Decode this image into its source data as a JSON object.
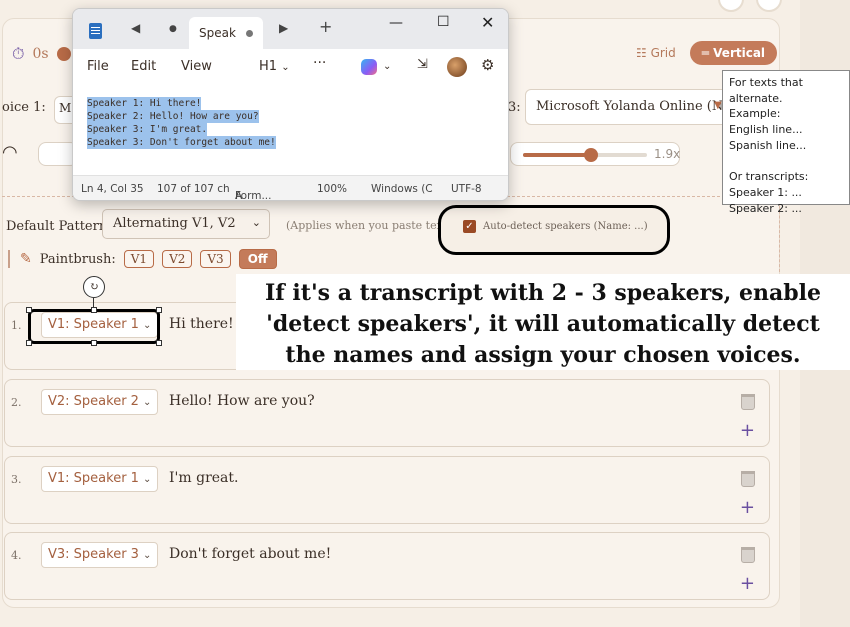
{
  "timer": {
    "value": "0s"
  },
  "view_toggle": {
    "grid_label": "Grid",
    "vertical_label": "Vertical"
  },
  "voices": {
    "left_label": "oice  1:",
    "left_value": "M",
    "right_label": "3:",
    "right_value": "Microsoft Yolanda Online (N..."
  },
  "speed": {
    "value": "1.9x",
    "fill_fraction": 0.55
  },
  "pattern": {
    "label": "Default Pattern:",
    "selected": "Alternating V1, V2",
    "note": "(Applies when you paste tex",
    "autodetect_label": "Auto-detect speakers (Name: ...)",
    "autodetect_checked": true
  },
  "paintbrush": {
    "label": "Paintbrush:",
    "chips": [
      "V1",
      "V2",
      "V3"
    ],
    "off_label": "Off"
  },
  "lines": [
    {
      "num": "1.",
      "speaker": "V1: Speaker 1",
      "text": "Hi there!"
    },
    {
      "num": "2.",
      "speaker": "V2: Speaker 2",
      "text": "Hello! How are you?"
    },
    {
      "num": "3.",
      "speaker": "V1: Speaker 1",
      "text": "I'm great."
    },
    {
      "num": "4.",
      "speaker": "V3: Speaker 3",
      "text": "Don't forget about me!"
    }
  ],
  "annotation": {
    "text": "If it's a transcript with 2 - 3 speakers, enable 'detect speakers', it will automatically detect the names and assign your chosen voices."
  },
  "tooltip": {
    "lines_top": [
      "For texts that alternate.",
      "Example:",
      "English line...",
      "Spanish line..."
    ],
    "lines_bottom": [
      "Or transcripts:",
      "Speaker 1: ...",
      "Speaker 2: ..."
    ]
  },
  "notepad": {
    "tab_title": "Speak",
    "menu": [
      "File",
      "Edit",
      "View"
    ],
    "heading_select": "H1",
    "editor_lines": [
      "Speaker 1: Hi there!",
      "Speaker 2: Hello! How are you?",
      "Speaker 3: I'm great.",
      "Speaker 3: Don't forget about me!"
    ],
    "status": {
      "position": "Ln 4, Col 35",
      "chars": "107 of 107 ch",
      "format": "Form...",
      "zoom": "100%",
      "line_ending": "Windows (C",
      "encoding": "UTF-8"
    }
  },
  "colors": {
    "accent": "#b86b47",
    "background": "#f6efe6",
    "highlight": "#9cc2ec"
  }
}
